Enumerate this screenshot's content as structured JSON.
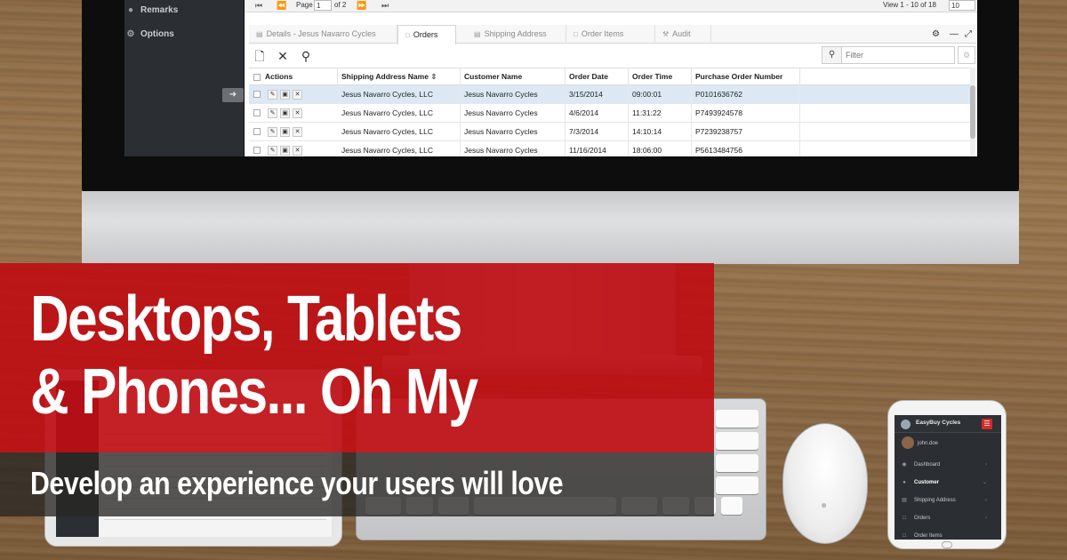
{
  "sidebar": {
    "items": [
      {
        "label": "Remarks",
        "icon": "comment-icon"
      },
      {
        "label": "Options",
        "icon": "gear-icon"
      }
    ]
  },
  "pager": {
    "page_label": "Page",
    "page_value": "1",
    "of_label": "of 2",
    "view_text": "View 1 - 10 of 18",
    "page_size": "10"
  },
  "tabs": [
    {
      "label": "Details - Jesus Navarro Cycles",
      "icon": "details-icon"
    },
    {
      "label": "Orders",
      "icon": "document-icon",
      "active": true
    },
    {
      "label": "Shipping Address",
      "icon": "address-icon"
    },
    {
      "label": "Order Items",
      "icon": "document-icon"
    },
    {
      "label": "Audit",
      "icon": "gavel-icon"
    }
  ],
  "filter": {
    "placeholder": "Filter"
  },
  "grid": {
    "columns": [
      "Actions",
      "Shipping Address Name",
      "Customer Name",
      "Order Date",
      "Order Time",
      "Purchase Order Number"
    ],
    "rows": [
      {
        "shipping": "Jesus Navarro Cycles, LLC",
        "customer": "Jesus Navarro Cycles",
        "date": "3/15/2014",
        "time": "09:00:01",
        "po": "P0101636762"
      },
      {
        "shipping": "Jesus Navarro Cycles, LLC",
        "customer": "Jesus Navarro Cycles",
        "date": "4/6/2014",
        "time": "11:31:22",
        "po": "P7493924578"
      },
      {
        "shipping": "Jesus Navarro Cycles, LLC",
        "customer": "Jesus Navarro Cycles",
        "date": "7/3/2014",
        "time": "14:10:14",
        "po": "P7239238757"
      },
      {
        "shipping": "Jesus Navarro Cycles, LLC",
        "customer": "Jesus Navarro Cycles",
        "date": "11/16/2014",
        "time": "18:06:00",
        "po": "P5613484756"
      }
    ]
  },
  "phone": {
    "brand": "EasyBuy Cycles",
    "user": "john.doe",
    "menu": [
      "Dashboard",
      "Customer",
      "Shipping Address",
      "Orders",
      "Order Items"
    ]
  },
  "banner": {
    "headline_line1": "Desktops, Tablets",
    "headline_line2": "& Phones... Oh My",
    "subline": "Develop an experience your users will love"
  },
  "colors": {
    "banner_red": "#be0e14",
    "banner_dark": "#282624",
    "sidebar_bg": "#2b2f33",
    "selected_row": "#dce9f5"
  }
}
